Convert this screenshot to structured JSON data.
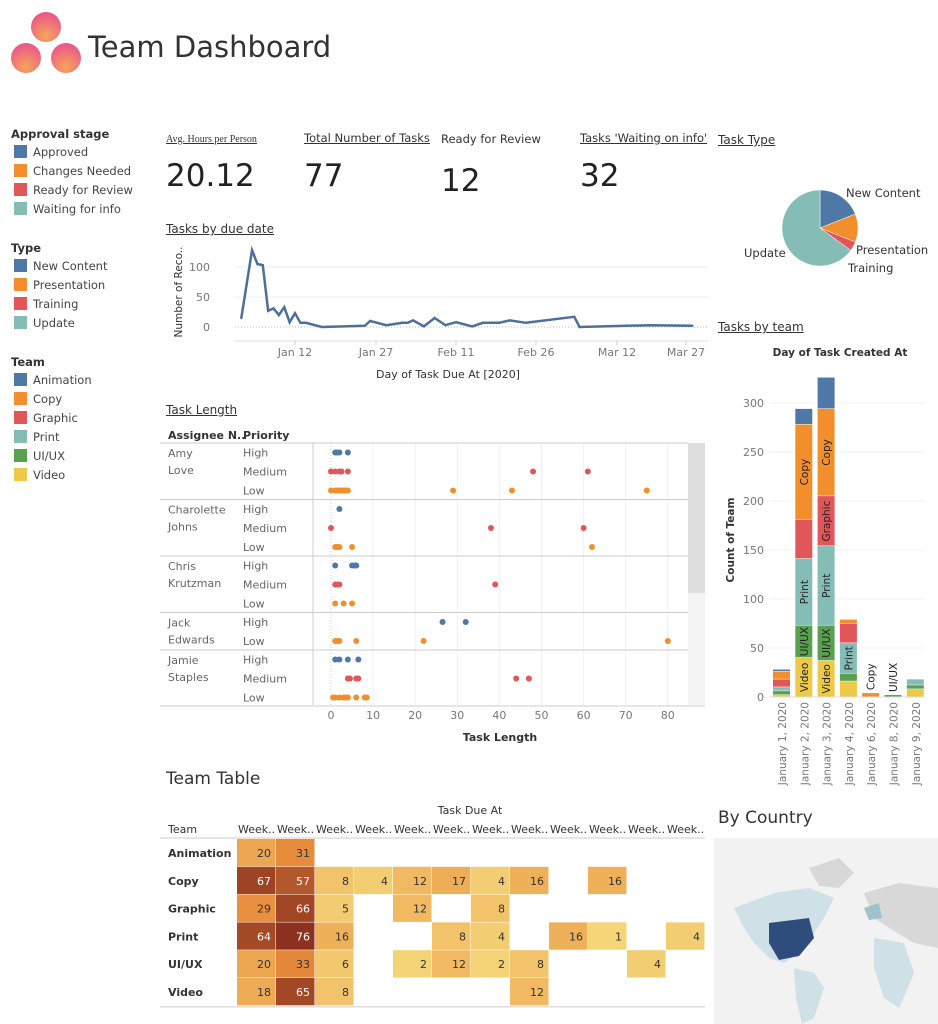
{
  "header": {
    "title": "Team Dashboard"
  },
  "colors": {
    "blue": "#4e79a7",
    "orange": "#f28e2b",
    "red": "#e15759",
    "teal": "#86bcb6",
    "green": "#59a14f",
    "yellow": "#edc948"
  },
  "legends": [
    {
      "title": "Approval stage",
      "items": [
        {
          "label": "Approved",
          "color": "#4e79a7"
        },
        {
          "label": "Changes Needed",
          "color": "#f28e2b"
        },
        {
          "label": "Ready for Review",
          "color": "#e15759"
        },
        {
          "label": "Waiting for info",
          "color": "#86bcb6"
        }
      ]
    },
    {
      "title": "Type",
      "items": [
        {
          "label": "New Content",
          "color": "#4e79a7"
        },
        {
          "label": "Presentation",
          "color": "#f28e2b"
        },
        {
          "label": "Training",
          "color": "#e15759"
        },
        {
          "label": "Update",
          "color": "#86bcb6"
        }
      ]
    },
    {
      "title": "Team",
      "items": [
        {
          "label": "Animation",
          "color": "#4e79a7"
        },
        {
          "label": "Copy",
          "color": "#f28e2b"
        },
        {
          "label": "Graphic",
          "color": "#e15759"
        },
        {
          "label": "Print",
          "color": "#86bcb6"
        },
        {
          "label": "UI/UX",
          "color": "#59a14f"
        },
        {
          "label": "Video",
          "color": "#edc948"
        }
      ]
    }
  ],
  "kpis": [
    {
      "label": "Avg. Hours per Person",
      "value": "20.12"
    },
    {
      "label": "Total Number of Tasks",
      "value": "77"
    },
    {
      "label": "Ready for Review",
      "value": "12"
    },
    {
      "label": "Tasks 'Waiting on info'",
      "value": "32"
    }
  ],
  "chart_data": [
    {
      "type": "line",
      "title": "Tasks by due date",
      "xlabel": "Day of Task Due At [2020]",
      "ylabel": "Number of Reco..",
      "x_ticks": [
        "Jan 12",
        "Jan 27",
        "Feb 11",
        "Feb 26",
        "Mar 12",
        "Mar 27"
      ],
      "y_ticks": [
        0,
        50,
        100
      ],
      "ylim": [
        0,
        130
      ],
      "grid": true,
      "x": [
        "2020-01-02",
        "2020-01-04",
        "2020-01-05",
        "2020-01-06",
        "2020-01-07",
        "2020-01-08",
        "2020-01-09",
        "2020-01-10",
        "2020-01-11",
        "2020-01-12",
        "2020-01-13",
        "2020-01-14",
        "2020-01-17",
        "2020-01-25",
        "2020-01-26",
        "2020-01-29",
        "2020-02-01",
        "2020-02-02",
        "2020-02-03",
        "2020-02-05",
        "2020-02-07",
        "2020-02-09",
        "2020-02-11",
        "2020-02-14",
        "2020-02-16",
        "2020-02-19",
        "2020-02-21",
        "2020-02-24",
        "2020-03-04",
        "2020-03-05",
        "2020-03-18",
        "2020-03-26"
      ],
      "y": [
        15,
        128,
        105,
        103,
        27,
        31,
        20,
        33,
        8,
        23,
        7,
        7,
        0,
        2,
        10,
        3,
        7,
        7,
        11,
        1,
        15,
        3,
        8,
        1,
        7,
        7,
        11,
        7,
        17,
        0,
        3,
        2
      ]
    },
    {
      "type": "pie",
      "title": "Task Type",
      "slices": [
        {
          "label": "New Content",
          "value": 19,
          "color": "#4e79a7"
        },
        {
          "label": "Presentation",
          "value": 12,
          "color": "#f28e2b"
        },
        {
          "label": "Training",
          "value": 4,
          "color": "#e15759"
        },
        {
          "label": "Update",
          "value": 65,
          "color": "#86bcb6"
        }
      ]
    },
    {
      "type": "scatter",
      "title": "Task Length",
      "xlabel": "Task Length",
      "col_headers": [
        "Assignee N..",
        "Priority"
      ],
      "xlim": [
        0,
        80
      ],
      "x_ticks": [
        0,
        10,
        20,
        30,
        40,
        50,
        60,
        70,
        80
      ],
      "rows": [
        {
          "assignee": "Amy Love",
          "groups": [
            {
              "priority": "High",
              "values": [
                1,
                1.5,
                2,
                4
              ]
            },
            {
              "priority": "Medium",
              "values": [
                0,
                1,
                2,
                2.5,
                4,
                48,
                61
              ]
            },
            {
              "priority": "Low",
              "values": [
                0,
                1,
                1.5,
                2,
                2.5,
                3,
                3.5,
                4,
                29,
                43,
                75
              ]
            }
          ]
        },
        {
          "assignee": "Charolette Johns",
          "groups": [
            {
              "priority": "High",
              "values": [
                2
              ]
            },
            {
              "priority": "Medium",
              "values": [
                0,
                38,
                60
              ]
            },
            {
              "priority": "Low",
              "values": [
                1,
                1.5,
                2,
                5,
                62
              ]
            }
          ]
        },
        {
          "assignee": "Chris Krutzman",
          "groups": [
            {
              "priority": "High",
              "values": [
                1,
                5,
                5.5,
                6
              ]
            },
            {
              "priority": "Medium",
              "values": [
                1,
                1.5,
                2,
                39
              ]
            },
            {
              "priority": "Low",
              "values": [
                1,
                3,
                5
              ]
            }
          ]
        },
        {
          "assignee": "Jack Edwards",
          "groups": [
            {
              "priority": "High",
              "values": [
                26.5,
                32
              ]
            },
            {
              "priority": "Low",
              "values": [
                1,
                1.5,
                2,
                6,
                22,
                80
              ]
            }
          ]
        },
        {
          "assignee": "Jamie Staples",
          "groups": [
            {
              "priority": "High",
              "values": [
                1,
                2,
                4,
                6.5
              ]
            },
            {
              "priority": "Medium",
              "values": [
                4,
                4.5,
                6,
                6.5,
                44,
                47
              ]
            },
            {
              "priority": "Low",
              "values": [
                0.5,
                1,
                2,
                3,
                3.5,
                4,
                6,
                8,
                8.5
              ]
            }
          ]
        }
      ]
    },
    {
      "type": "bar",
      "stacked": true,
      "title": "Tasks by team",
      "subtitle": "Day of Task Created At",
      "ylabel": "Count of Team",
      "ylim": [
        0,
        330
      ],
      "y_ticks": [
        0,
        50,
        100,
        150,
        200,
        250,
        300
      ],
      "categories": [
        "January 1, 2020",
        "January 2, 2020",
        "January 3, 2020",
        "January 4, 2020",
        "January 6, 2020",
        "January 8, 2020",
        "January 9, 2020"
      ],
      "series": [
        {
          "name": "Video",
          "color": "#edc948",
          "values": [
            2,
            40,
            37,
            16,
            0,
            0,
            8
          ]
        },
        {
          "name": "UI/UX",
          "color": "#59a14f",
          "values": [
            4,
            33,
            36,
            8,
            0,
            2,
            4
          ]
        },
        {
          "name": "Print",
          "color": "#86bcb6",
          "values": [
            4,
            68,
            81,
            31,
            0,
            0,
            6
          ]
        },
        {
          "name": "Graphic",
          "color": "#e15759",
          "values": [
            8,
            40,
            51,
            20,
            0,
            0,
            0
          ]
        },
        {
          "name": "Copy",
          "color": "#f28e2b",
          "values": [
            8,
            97,
            89,
            4,
            4,
            0,
            0
          ]
        },
        {
          "name": "Animation",
          "color": "#4e79a7",
          "values": [
            2,
            16,
            32,
            0,
            0,
            0,
            0
          ]
        }
      ],
      "labels": [
        [
          1,
          "Video"
        ],
        [
          1,
          "UI/UX"
        ],
        [
          1,
          "Print"
        ],
        [
          1,
          "Copy"
        ],
        [
          2,
          "Video"
        ],
        [
          2,
          "UI/UX"
        ],
        [
          2,
          "Print"
        ],
        [
          2,
          "Graphic"
        ],
        [
          2,
          "Copy"
        ],
        [
          3,
          "Print"
        ],
        [
          4,
          "Copy"
        ],
        [
          5,
          "UI/UX"
        ]
      ]
    },
    {
      "type": "heatmap",
      "title": "Team Table",
      "column_group": "Task Due At",
      "row_header": "Team",
      "columns": [
        "Week..",
        "Week..",
        "Week..",
        "Week..",
        "Week..",
        "Week..",
        "Week..",
        "Week..",
        "Week..",
        "Week..",
        "Week..",
        "Week.."
      ],
      "rows": [
        {
          "team": "Animation",
          "values": [
            20,
            31,
            null,
            null,
            null,
            null,
            null,
            null,
            null,
            null,
            null,
            null
          ]
        },
        {
          "team": "Copy",
          "values": [
            67,
            57,
            8,
            4,
            12,
            17,
            4,
            16,
            null,
            16,
            null,
            null
          ]
        },
        {
          "team": "Graphic",
          "values": [
            29,
            66,
            5,
            null,
            12,
            null,
            8,
            null,
            null,
            null,
            null,
            null
          ]
        },
        {
          "team": "Print",
          "values": [
            64,
            76,
            16,
            null,
            null,
            8,
            4,
            null,
            16,
            1,
            null,
            4
          ]
        },
        {
          "team": "UI/UX",
          "values": [
            20,
            33,
            6,
            null,
            2,
            12,
            2,
            8,
            null,
            null,
            4,
            null
          ]
        },
        {
          "team": "Video",
          "values": [
            18,
            65,
            8,
            null,
            null,
            null,
            null,
            12,
            null,
            null,
            null,
            null
          ]
        }
      ]
    }
  ],
  "map": {
    "title": "By Country"
  }
}
